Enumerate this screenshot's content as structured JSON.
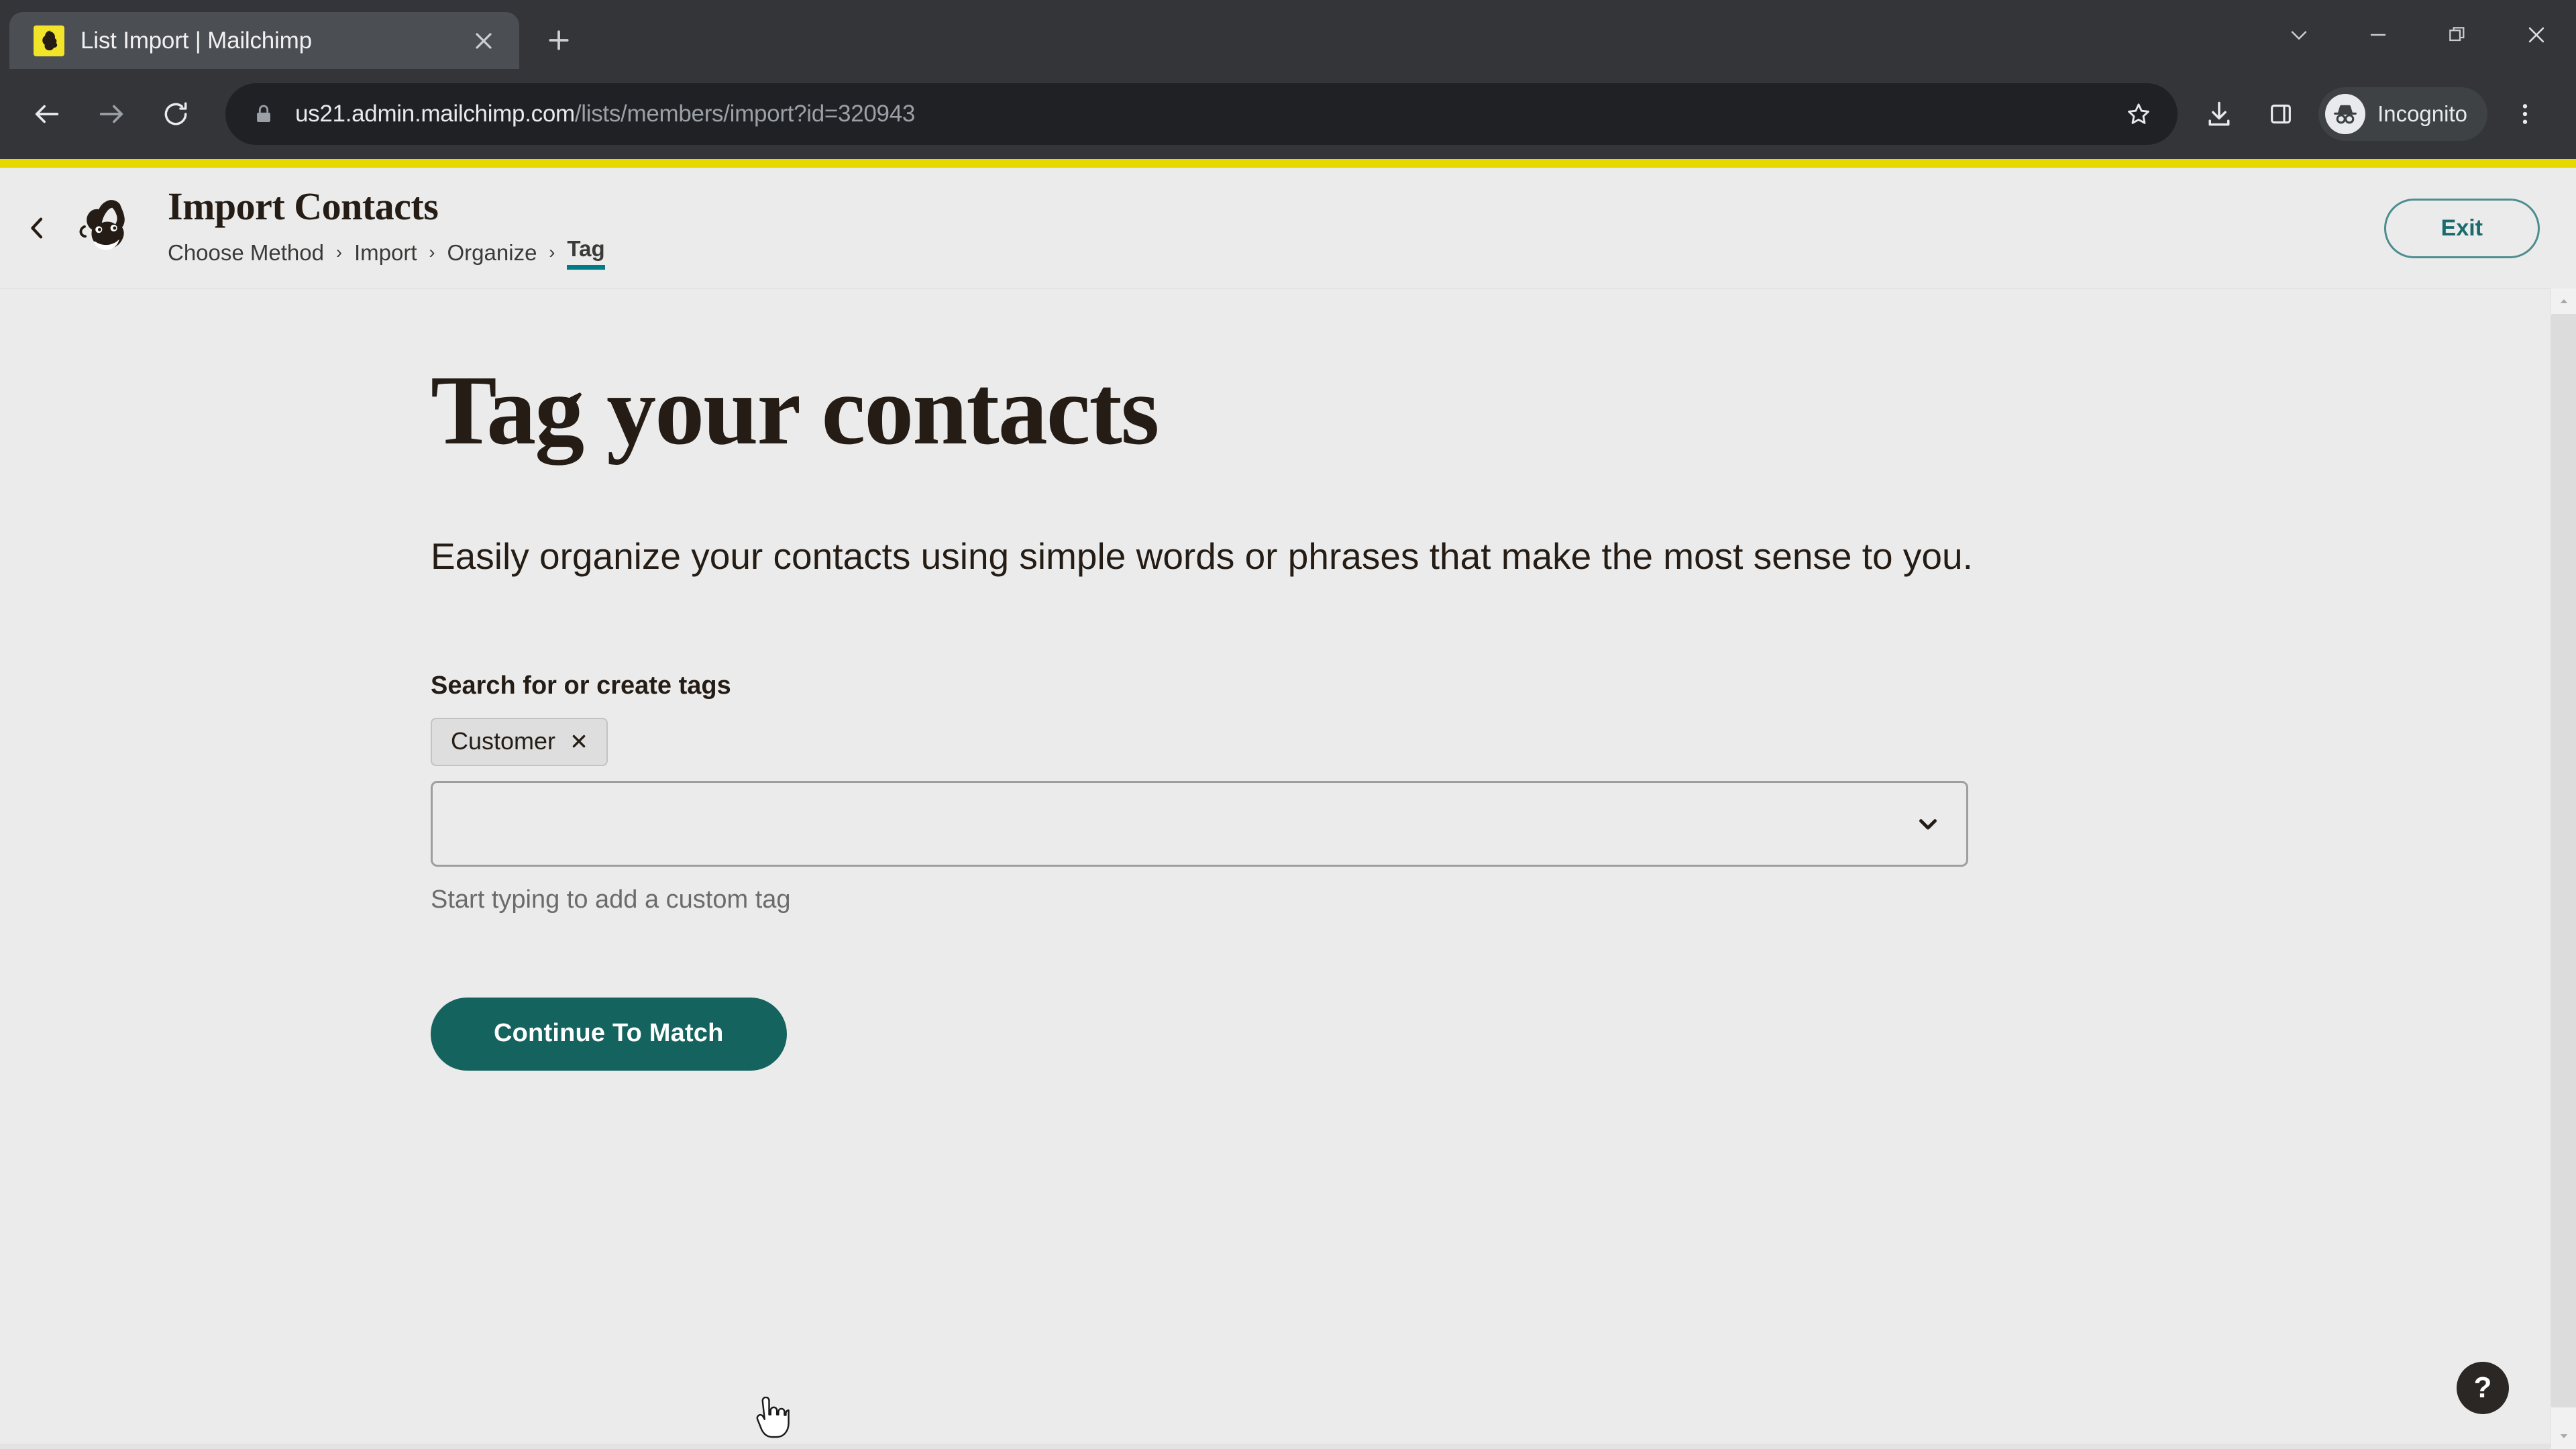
{
  "browser": {
    "tab": {
      "title": "List Import | Mailchimp",
      "favicon_name": "mailchimp-favicon",
      "close_label": "×"
    },
    "newtab_label": "+",
    "window_controls": {
      "tab_search": "tab-search",
      "minimize": "minimize",
      "restore": "restore",
      "close": "close"
    },
    "toolbar": {
      "back": "back",
      "forward": "forward",
      "reload": "reload",
      "url_host": "us21.admin.mailchimp.com",
      "url_path": "/lists/members/import?id=320943",
      "url_full": "us21.admin.mailchimp.com/lists/members/import?id=320943",
      "secure_icon": "lock-icon",
      "bookmark": "bookmark-star",
      "downloads": "downloads",
      "side_panel": "side-panel",
      "profile_label": "Incognito",
      "menu": "three-dot-menu"
    }
  },
  "app": {
    "brand_bar_color": "#e6d900",
    "accent_color": "#007c89",
    "cta_color": "#14635e",
    "logo_name": "mailchimp-freddie-logo",
    "back_label": "‹",
    "title": "Import Contacts",
    "breadcrumb": [
      {
        "label": "Choose Method",
        "active": false
      },
      {
        "label": "Import",
        "active": false
      },
      {
        "label": "Organize",
        "active": false
      },
      {
        "label": "Tag",
        "active": true
      }
    ],
    "breadcrumb_separator": "›",
    "exit_label": "Exit"
  },
  "main": {
    "heading": "Tag your contacts",
    "subheading": "Easily organize your contacts using simple words or phrases that make the most sense to you.",
    "field": {
      "label": "Search for or create tags",
      "tags": [
        {
          "label": "Customer",
          "remove_label": "✕"
        }
      ],
      "select_value": "",
      "select_placeholder": "",
      "helper_text": "Start typing to add a custom tag"
    },
    "cta_label": "Continue To Match"
  },
  "help": {
    "fab_label": "?"
  }
}
